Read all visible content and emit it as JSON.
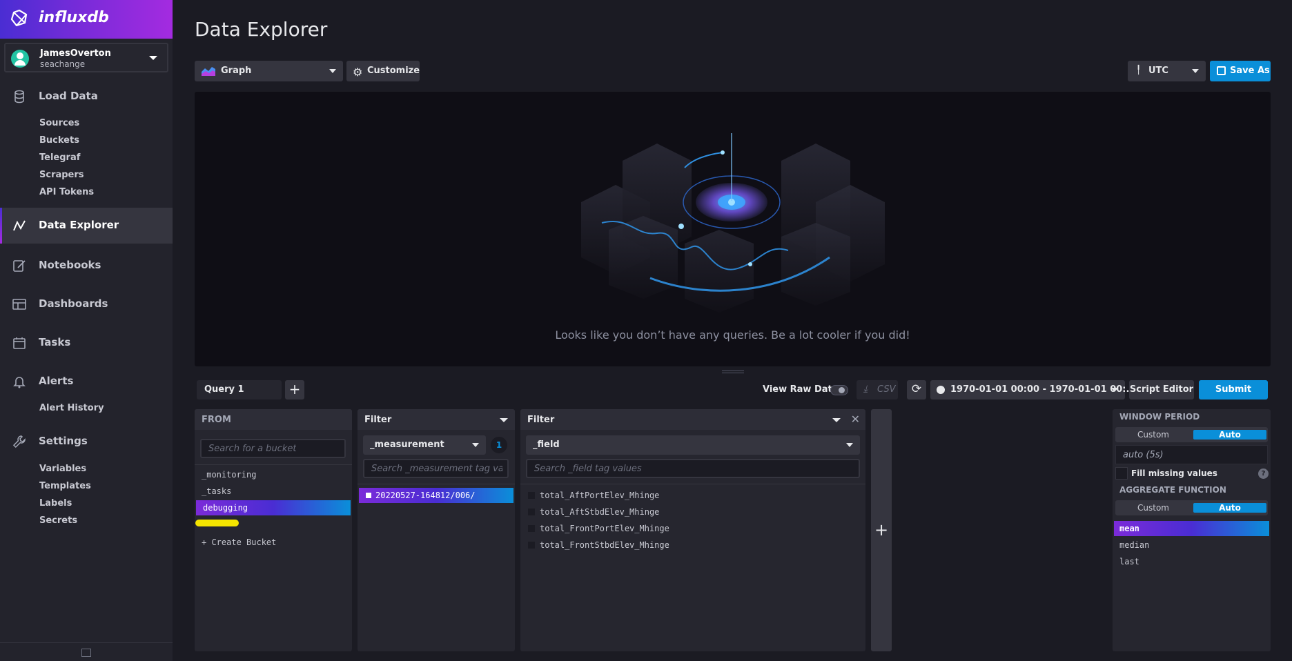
{
  "app": {
    "brand": "influxdb"
  },
  "account": {
    "name": "JamesOverton",
    "org": "seachange"
  },
  "sidebar": {
    "load_data": {
      "label": "Load Data",
      "items": [
        "Sources",
        "Buckets",
        "Telegraf",
        "Scrapers",
        "API Tokens"
      ]
    },
    "data_explorer": {
      "label": "Data Explorer"
    },
    "notebooks": {
      "label": "Notebooks"
    },
    "dashboards": {
      "label": "Dashboards"
    },
    "tasks": {
      "label": "Tasks"
    },
    "alerts": {
      "label": "Alerts",
      "items": [
        "Alert History"
      ]
    },
    "settings": {
      "label": "Settings",
      "items": [
        "Variables",
        "Templates",
        "Labels",
        "Secrets"
      ]
    }
  },
  "header": {
    "title": "Data Explorer",
    "graph_type": "Graph",
    "customize_label": "Customize",
    "timezone": "UTC",
    "save_as_label": "Save As"
  },
  "graph": {
    "empty_message": "Looks like you don’t have any queries. Be a lot cooler if you did!"
  },
  "query_bar": {
    "query_tab": "Query 1",
    "add_query": "+",
    "view_raw_data": "View Raw Data",
    "csv_label": "CSV",
    "time_range": "1970-01-01 00:00 - 1970-01-01 00:...",
    "script_editor": "Script Editor",
    "submit": "Submit"
  },
  "from_card": {
    "title": "FROM",
    "search_placeholder": "Search for a bucket",
    "buckets": [
      "_monitoring",
      "_tasks",
      "debugging"
    ],
    "selected_bucket": "debugging",
    "create_bucket": "+ Create Bucket"
  },
  "filter_card_1": {
    "title": "Filter",
    "key": "_measurement",
    "count": "1",
    "search_placeholder": "Search _measurement tag values",
    "values": [
      "20220527-164812/006/"
    ]
  },
  "filter_card_2": {
    "title": "Filter",
    "key": "_field",
    "search_placeholder": "Search _field tag values",
    "values": [
      "total_AftPortElev_Mhinge",
      "total_AftStbdElev_Mhinge",
      "total_FrontPortElev_Mhinge",
      "total_FrontStbdElev_Mhinge"
    ]
  },
  "add_filter": "+",
  "right_panel": {
    "window_period_title": "WINDOW PERIOD",
    "custom": "Custom",
    "auto": "Auto",
    "window_value": "auto (5s)",
    "fill_missing": "Fill missing values",
    "help": "?",
    "aggregate_title": "AGGREGATE FUNCTION",
    "functions": [
      "mean",
      "median",
      "last"
    ],
    "selected_function": "mean"
  },
  "colors": {
    "accent": "#0a8fd9",
    "brand_purple": "#7b2bd9",
    "background": "#1b1b23",
    "panel": "#26262f"
  }
}
